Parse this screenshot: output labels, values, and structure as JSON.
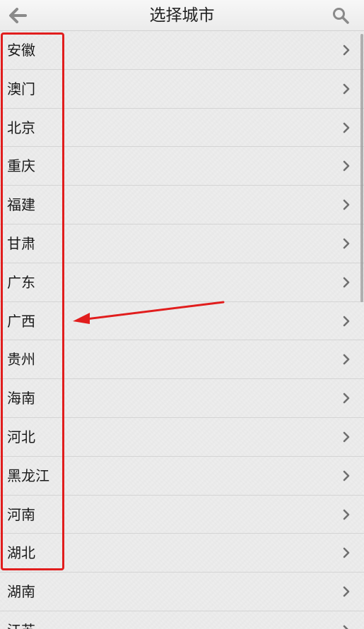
{
  "header": {
    "title": "选择城市"
  },
  "provinces": [
    {
      "name": "安徽"
    },
    {
      "name": "澳门"
    },
    {
      "name": "北京"
    },
    {
      "name": "重庆"
    },
    {
      "name": "福建"
    },
    {
      "name": "甘肃"
    },
    {
      "name": "广东"
    },
    {
      "name": "广西"
    },
    {
      "name": "贵州"
    },
    {
      "name": "海南"
    },
    {
      "name": "河北"
    },
    {
      "name": "黑龙江"
    },
    {
      "name": "河南"
    },
    {
      "name": "湖北"
    },
    {
      "name": "湖南"
    },
    {
      "name": "江苏"
    }
  ],
  "colors": {
    "annotation": "#e11d1d",
    "divider": "#d4d4d4",
    "text": "#1a1a1a"
  },
  "icons": {
    "back": "arrow-left-icon",
    "search": "search-icon",
    "row_chevron": "chevron-right-icon"
  }
}
